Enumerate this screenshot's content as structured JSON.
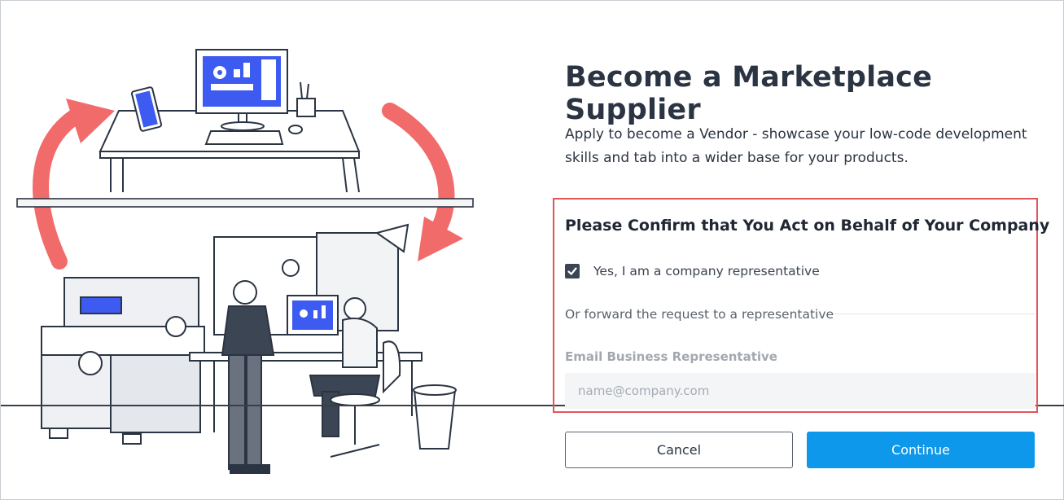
{
  "dialog": {
    "title": "Become a Marketplace Supplier",
    "intro": "Apply to become a Vendor - showcase your low-code development skills and tab into a wider base for your products."
  },
  "confirm": {
    "heading": "Please Confirm that You Act on Behalf of Your Company",
    "checkbox_label": "Yes, I am a company representative",
    "checkbox_checked": true,
    "or_text": "Or forward the request to a representative",
    "email_label": "Email Business Representative",
    "email_placeholder": "name@company.com",
    "email_value": ""
  },
  "buttons": {
    "cancel": "Cancel",
    "continue": "Continue"
  },
  "colors": {
    "accent": "#0d98ec",
    "highlight_border": "#e2565a",
    "arrow": "#f26b6b",
    "screen_blue": "#3d5af1"
  }
}
